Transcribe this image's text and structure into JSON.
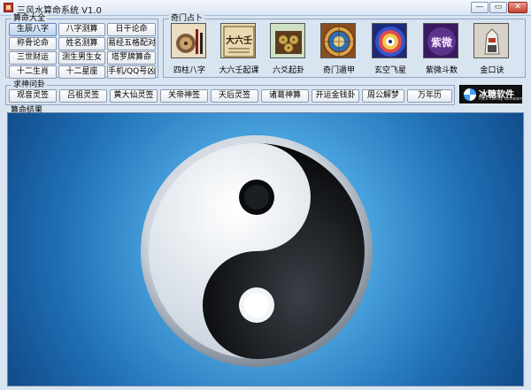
{
  "window": {
    "title": "三风水算命系统 V1.0",
    "min_label": "—",
    "max_label": "▭",
    "close_label": "✕"
  },
  "groups": {
    "fortune": "算命大全",
    "gate": "奇门占卜",
    "lots": "求神问卦",
    "result": "算命结果"
  },
  "fortune_buttons": [
    "生辰八字",
    "八字测算",
    "日干论命",
    "称骨论命",
    "姓名测算",
    "易经五格配对",
    "三世财运",
    "测生男生女",
    "塔罗牌算命",
    "十二生肖",
    "十二星座",
    "手机/QQ号凶吉"
  ],
  "active_button": "生辰八字",
  "gate_tiles": [
    {
      "label": "四柱八字",
      "icon": "bazi-icon"
    },
    {
      "label": "大六壬起课",
      "icon": "daliuren-icon",
      "art_text": "大六壬"
    },
    {
      "label": "六爻起卦",
      "icon": "liuyao-icon"
    },
    {
      "label": "奇门遁甲",
      "icon": "qimen-icon"
    },
    {
      "label": "玄空飞星",
      "icon": "xuankong-icon"
    },
    {
      "label": "紫微斗数",
      "icon": "ziwei-icon",
      "art_text": "紫微"
    },
    {
      "label": "金口诀",
      "icon": "jinkou-icon"
    }
  ],
  "lot_buttons": [
    "观音灵签",
    "吕祖灵签",
    "黄大仙灵签",
    "关帝神签",
    "天后灵签",
    "诸葛神算",
    "开运金钱卦",
    "周公解梦",
    "万年历"
  ],
  "logo": {
    "main": "冰糖软件",
    "sub": "rock candy software"
  },
  "colors": {
    "accent": "#5f86bd",
    "window_bg": "#d9e4f1",
    "result_bg": "#1f6fb5"
  }
}
